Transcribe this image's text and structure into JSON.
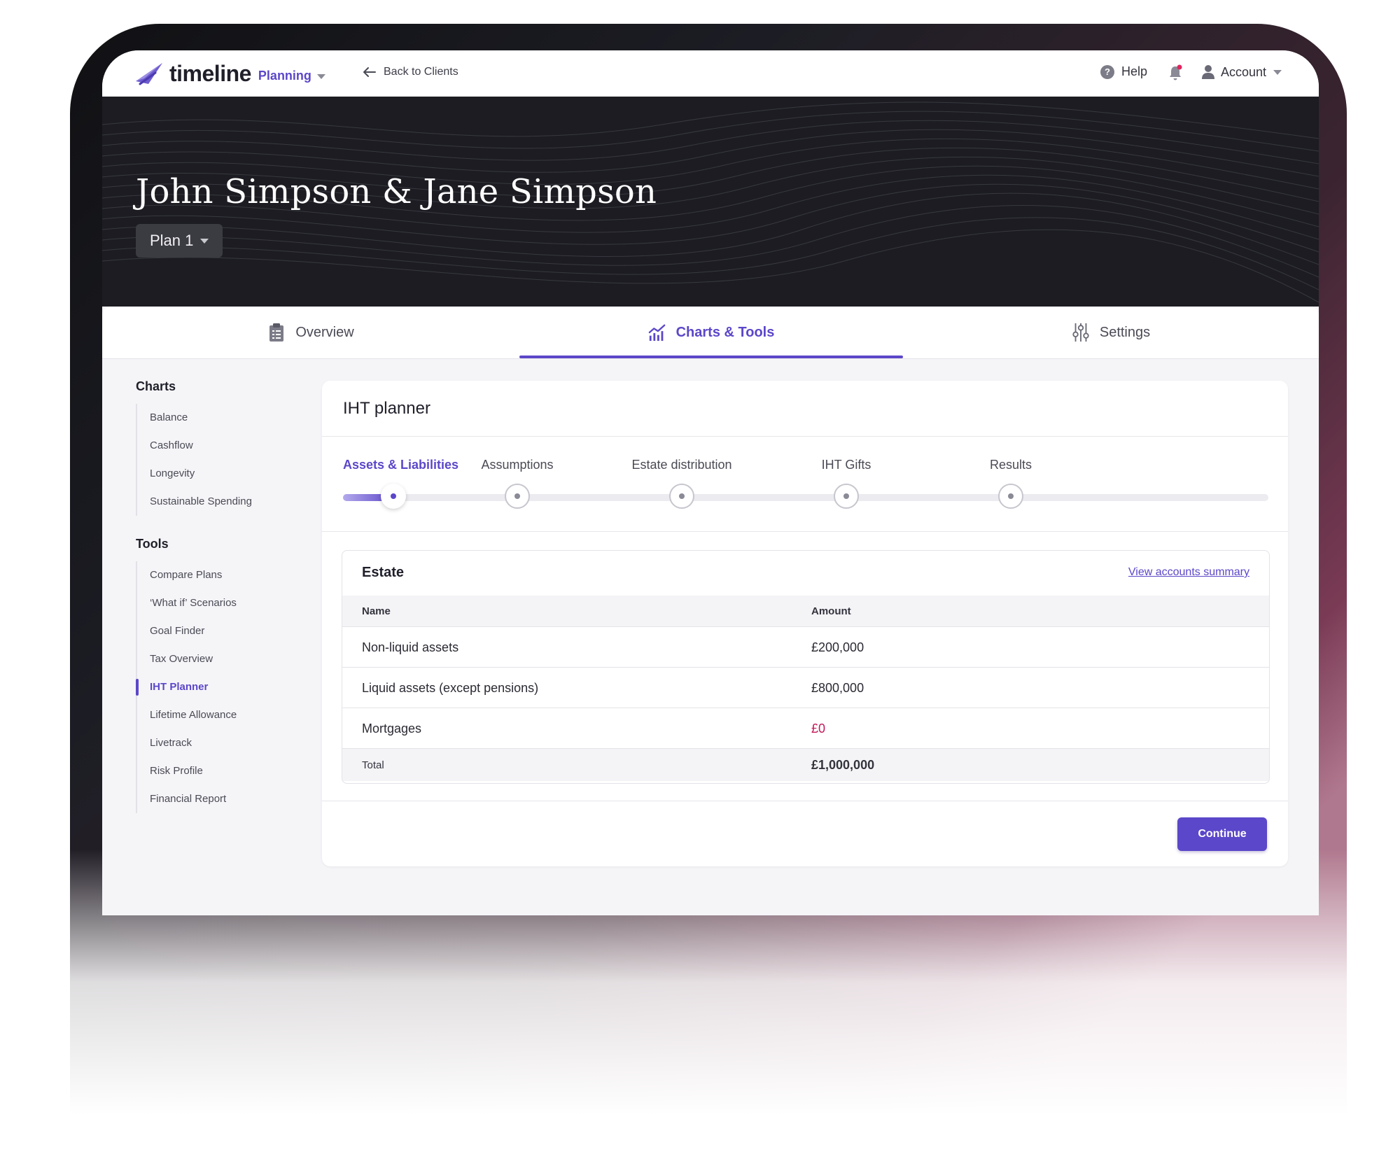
{
  "topbar": {
    "brand": "timeline",
    "product": "Planning",
    "back_label": "Back to Clients",
    "help_label": "Help",
    "account_label": "Account"
  },
  "hero": {
    "client_name": "John Simpson & Jane Simpson",
    "plan_label": "Plan 1"
  },
  "tabs": [
    {
      "label": "Overview",
      "icon": "clipboard-icon"
    },
    {
      "label": "Charts & Tools",
      "icon": "chart-icon",
      "active": true
    },
    {
      "label": "Settings",
      "icon": "sliders-icon"
    }
  ],
  "sidebar": {
    "charts_heading": "Charts",
    "charts": [
      "Balance",
      "Cashflow",
      "Longevity",
      "Sustainable Spending"
    ],
    "tools_heading": "Tools",
    "tools": [
      "Compare Plans",
      "‘What if’ Scenarios",
      "Goal Finder",
      "Tax Overview",
      "IHT Planner",
      "Lifetime Allowance",
      "Livetrack",
      "Risk Profile",
      "Financial Report"
    ],
    "active_tool": "IHT Planner"
  },
  "card": {
    "title": "IHT planner",
    "steps": [
      "Assets & Liabilities",
      "Assumptions",
      "Estate distribution",
      "IHT Gifts",
      "Results"
    ],
    "active_step": 0,
    "estate": {
      "title": "Estate",
      "link": "View accounts summary",
      "columns": [
        "Name",
        "Amount"
      ],
      "rows": [
        {
          "name": "Non-liquid assets",
          "amount": "£200,000"
        },
        {
          "name": "Liquid assets (except pensions)",
          "amount": "£800,000"
        },
        {
          "name": "Mortgages",
          "amount": "£0"
        }
      ],
      "total_label": "Total",
      "total_amount": "£1,000,000"
    },
    "continue_label": "Continue"
  },
  "colors": {
    "accent": "#5b47c9",
    "negative": "#c2185b",
    "hero_bg": "#1c1c22"
  }
}
